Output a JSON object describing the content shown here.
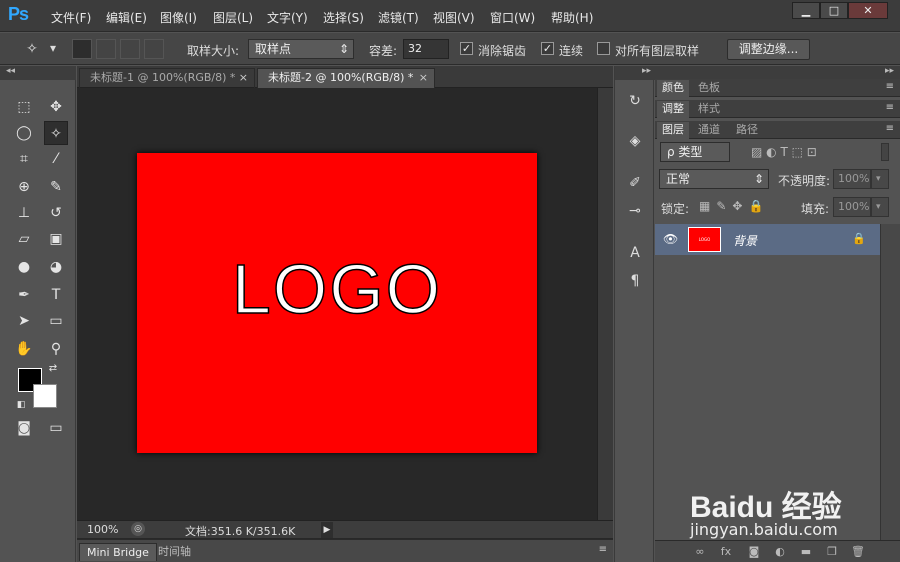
{
  "app": {
    "logo_text": "Ps"
  },
  "menu": [
    "文件(F)",
    "编辑(E)",
    "图像(I)",
    "图层(L)",
    "文字(Y)",
    "选择(S)",
    "滤镜(T)",
    "视图(V)",
    "窗口(W)",
    "帮助(H)"
  ],
  "window_controls": {
    "minimize": "▁",
    "maximize": "□",
    "close": "✕"
  },
  "options": {
    "sample_size_label": "取样大小:",
    "sample_size_value": "取样点",
    "tolerance_label": "容差:",
    "tolerance_value": "32",
    "anti_alias_label": "消除锯齿",
    "anti_alias_checked": true,
    "contiguous_label": "连续",
    "contiguous_checked": true,
    "sample_all_label": "对所有图层取样",
    "sample_all_checked": false,
    "refine_edge_label": "调整边缘..."
  },
  "tabs": [
    {
      "label": "未标题-1 @ 100%(RGB/8) *",
      "active": false
    },
    {
      "label": "未标题-2 @ 100%(RGB/8) *",
      "active": true
    }
  ],
  "canvas": {
    "background": "#ff0000",
    "text": "LOGO"
  },
  "status": {
    "zoom": "100%",
    "doc_info": "文档:351.6 K/351.6K"
  },
  "bottom_tabs": [
    "Mini Bridge",
    "时间轴"
  ],
  "panels": {
    "color_tabs": [
      "颜色",
      "色板"
    ],
    "adjust_tabs": [
      "调整",
      "样式"
    ],
    "layer_tabs": [
      "图层",
      "通道",
      "路径"
    ],
    "filter_type": "ρ 类型",
    "blend_mode": "正常",
    "opacity_label": "不透明度:",
    "opacity_value": "100%",
    "lock_label": "锁定:",
    "fill_label": "填充:",
    "fill_value": "100%",
    "layer_name": "背景",
    "layer_thumb_text": "LOGO"
  },
  "watermark": {
    "brand": "Baidu 经验",
    "url": "jingyan.baidu.com"
  }
}
